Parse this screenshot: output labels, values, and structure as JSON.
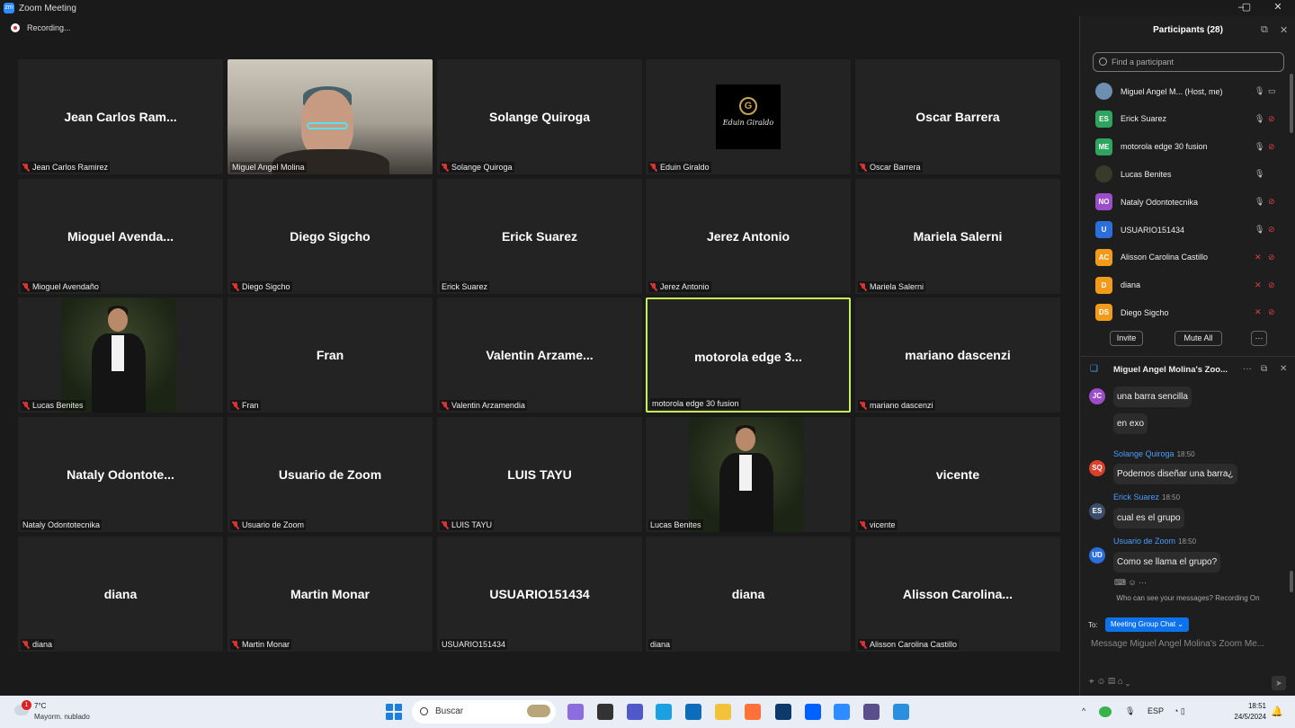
{
  "window": {
    "title": "Zoom Meeting",
    "controls": [
      "–",
      "▢",
      "✕"
    ]
  },
  "recording": {
    "label": "Recording..."
  },
  "tiles": [
    {
      "big": "Jean Carlos Ram...",
      "name": "Jean Carlos Ramirez",
      "muted": true,
      "type": "name"
    },
    {
      "big": "",
      "name": "Miguel Angel Molina",
      "muted": false,
      "type": "video-room"
    },
    {
      "big": "Solange Quiroga",
      "name": "Solange Quiroga",
      "muted": true,
      "type": "name"
    },
    {
      "big": "",
      "name": "Eduin Giraldo",
      "muted": true,
      "type": "logo",
      "logo_text": "Eduin Giraldo",
      "logo_letter": "G"
    },
    {
      "big": "Oscar Barrera",
      "name": "Oscar Barrera",
      "muted": true,
      "type": "name"
    },
    {
      "big": "Mioguel  Avenda...",
      "name": "Mioguel Avendaño",
      "muted": true,
      "type": "name"
    },
    {
      "big": "Diego Sigcho",
      "name": "Diego Sigcho",
      "muted": true,
      "type": "name"
    },
    {
      "big": "Erick Suarez",
      "name": "Erick Suarez",
      "muted": false,
      "type": "name"
    },
    {
      "big": "Jerez Antonio",
      "name": "Jerez Antonio",
      "muted": true,
      "type": "name"
    },
    {
      "big": "Mariela Salerni",
      "name": "Mariela Salerni",
      "muted": true,
      "type": "name"
    },
    {
      "big": "",
      "name": "Lucas Benites",
      "muted": true,
      "type": "photo"
    },
    {
      "big": "Fran",
      "name": "Fran",
      "muted": true,
      "type": "name"
    },
    {
      "big": "Valentin  Arzame...",
      "name": "Valentin Arzamendia",
      "muted": true,
      "type": "name"
    },
    {
      "big": "motorola  edge  3...",
      "name": "motorola edge 30 fusion",
      "muted": false,
      "type": "name",
      "active": true
    },
    {
      "big": "mariano  dascenzi",
      "name": "mariano dascenzi",
      "muted": true,
      "type": "name"
    },
    {
      "big": "Nataly  Odontote...",
      "name": "Nataly Odontotecnika",
      "muted": false,
      "type": "name"
    },
    {
      "big": "Usuario de Zoom",
      "name": "Usuario de Zoom",
      "muted": true,
      "type": "name"
    },
    {
      "big": "LUIS TAYU",
      "name": "LUIS TAYU",
      "muted": true,
      "type": "name"
    },
    {
      "big": "",
      "name": "Lucas Benites",
      "muted": false,
      "type": "photo"
    },
    {
      "big": "vicente",
      "name": "vicente",
      "muted": true,
      "type": "name"
    },
    {
      "big": "diana",
      "name": "diana",
      "muted": true,
      "type": "name"
    },
    {
      "big": "Martin Monar",
      "name": "Martin Monar",
      "muted": true,
      "type": "name"
    },
    {
      "big": "USUARIO151434",
      "name": "USUARIO151434",
      "muted": false,
      "type": "name"
    },
    {
      "big": "diana",
      "name": "diana",
      "muted": false,
      "type": "name"
    },
    {
      "big": "Alisson  Carolina...",
      "name": "Alisson Carolina Castillo",
      "muted": true,
      "type": "name"
    }
  ],
  "participants": {
    "title": "Participants (28)",
    "search_placeholder": "Find a participant",
    "list": [
      {
        "initials": "",
        "name": "Miguel Angel M... (Host, me)",
        "color": "#6d8fb0",
        "mic": "on",
        "cam": "on"
      },
      {
        "initials": "ES",
        "name": "Erick Suarez",
        "color": "#2ea55f",
        "mic": "on",
        "cam": "off"
      },
      {
        "initials": "ME",
        "name": "motorola edge 30 fusion",
        "color": "#2ea55f",
        "mic": "on",
        "cam": "off"
      },
      {
        "initials": "",
        "name": "Lucas Benites",
        "color": "#3a3a2a",
        "mic": "on",
        "cam": "none"
      },
      {
        "initials": "NO",
        "name": "Nataly Odontotecnika",
        "color": "#9b4dca",
        "mic": "on",
        "cam": "off"
      },
      {
        "initials": "U",
        "name": "USUARIO151434",
        "color": "#2a6fdb",
        "mic": "on",
        "cam": "off"
      },
      {
        "initials": "AC",
        "name": "Alisson Carolina Castillo",
        "color": "#f29a1a",
        "mic": "off",
        "cam": "off"
      },
      {
        "initials": "D",
        "name": "diana",
        "color": "#f29a1a",
        "mic": "off",
        "cam": "off"
      },
      {
        "initials": "DS",
        "name": "Diego Sigcho",
        "color": "#f29a1a",
        "mic": "off",
        "cam": "off"
      }
    ],
    "invite_label": "Invite",
    "mute_all_label": "Mute All",
    "more_label": "···"
  },
  "chat": {
    "title": "Miguel Angel Molina's Zoo...",
    "messages": [
      {
        "initials": "JC",
        "color": "#9b4dca",
        "sender": "",
        "time": "",
        "text": "una barra sencilla"
      },
      {
        "initials": "",
        "color": "",
        "sender": "",
        "time": "",
        "text": "en exo"
      },
      {
        "initials": "SQ",
        "color": "#d9412b",
        "sender": "Solange Quiroga",
        "time": "18:50",
        "text": "Podemos diseñar una barra¿"
      },
      {
        "initials": "ES",
        "color": "#3a4e6a",
        "sender": "Erick Suarez",
        "time": "18:50",
        "text": "cual es el grupo"
      },
      {
        "initials": "UD",
        "color": "#2a6fdb",
        "sender": "Usuario de Zoom",
        "time": "18:50",
        "text": "Como se llama el grupo?"
      }
    ],
    "who_can_see": "Who can see your messages? Recording On",
    "to_label": "To:",
    "to_target": "Meeting Group Chat ⌄",
    "compose_placeholder": "Message Miguel Angel Molina's Zoom Me...",
    "tools": "⌖  ☺  ▤  ⌂  ⌄",
    "send_icon": "➤"
  },
  "taskbar": {
    "weather_temp": "7°C",
    "weather_cond": "Mayorm. nublado",
    "weather_badge": "1",
    "search_label": "Buscar",
    "tray": {
      "chevron": "^",
      "lang": "ESP",
      "icons": "◔ ▯"
    },
    "time": "18:51",
    "date": "24/5/2024",
    "apps": [
      {
        "name": "copilot-icon",
        "color": "#8b6de0"
      },
      {
        "name": "taskview-icon",
        "color": "#333333"
      },
      {
        "name": "teams-icon",
        "color": "#5059c9"
      },
      {
        "name": "edge-icon",
        "color": "#1ba1e2"
      },
      {
        "name": "store-icon",
        "color": "#0f6cbd"
      },
      {
        "name": "explorer-icon",
        "color": "#f3c13a"
      },
      {
        "name": "firefox-icon",
        "color": "#ff7139"
      },
      {
        "name": "app-blue-icon",
        "color": "#0b3a6b"
      },
      {
        "name": "dropbox-icon",
        "color": "#0061fe"
      },
      {
        "name": "zoom-icon",
        "color": "#2d8cff"
      },
      {
        "name": "exo-icon",
        "color": "#5a4e8c"
      },
      {
        "name": "photos-icon",
        "color": "#2b8fe0"
      }
    ]
  }
}
